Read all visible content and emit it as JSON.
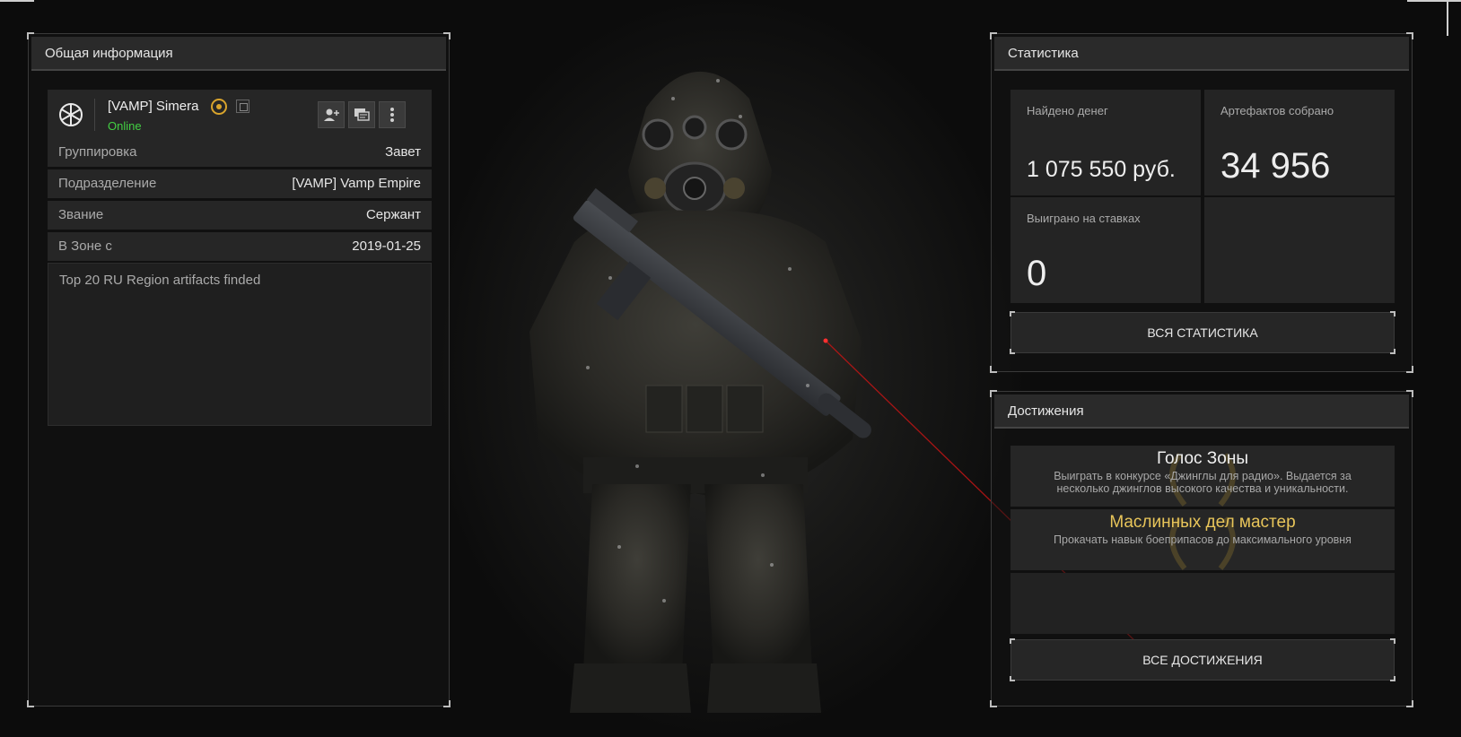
{
  "general": {
    "title": "Общая информация",
    "player": {
      "name": "[VAMP] Simera",
      "status": "Online"
    },
    "rows": [
      {
        "key": "Группировка",
        "value": "Завет"
      },
      {
        "key": "Подразделение",
        "value": "[VAMP] Vamp Empire"
      },
      {
        "key": "Звание",
        "value": "Сержант"
      },
      {
        "key": "В Зоне с",
        "value": "2019-01-25"
      }
    ],
    "bio": "Top 20 RU Region artifacts finded"
  },
  "stats": {
    "title": "Статистика",
    "cells": [
      {
        "label": "Найдено денег",
        "value": "1 075 550 руб."
      },
      {
        "label": "Артефактов собрано",
        "value": "34 956"
      },
      {
        "label": "Выиграно на ставках",
        "value": "0"
      }
    ],
    "all_button": "ВСЯ СТАТИСТИКА"
  },
  "achievements": {
    "title": "Достижения",
    "items": [
      {
        "title": "Голос Зоны",
        "description": "Выиграть в конкурсе «Джинглы для радио». Выдается за несколько джинглов высокого качества и уникальности.",
        "color": "#f0f0f0"
      },
      {
        "title": "Маслинных дел мастер",
        "description": "Прокачать навык боеприпасов до максимального уровня",
        "color": "#e8c55a"
      }
    ],
    "all_button": "ВСЕ ДОСТИЖЕНИЯ"
  },
  "colors": {
    "online": "#43d043",
    "gold": "#e8c55a",
    "laser": "#d01a1a"
  },
  "icons": {
    "faction": "faction-logo-icon",
    "add_friend": "add-friend-icon",
    "message": "message-icon",
    "more": "more-vertical-icon",
    "rank": "rank-badge-icon",
    "copy": "copy-icon"
  }
}
